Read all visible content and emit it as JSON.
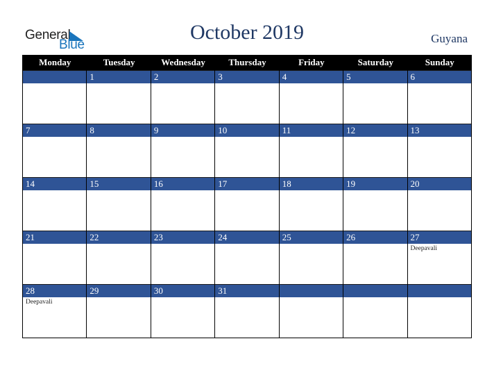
{
  "logo": {
    "word1": "General",
    "word2": "Blue"
  },
  "title": "October 2019",
  "country": "Guyana",
  "colors": {
    "title": "#1f3864",
    "band": "#2f5496",
    "header": "#000000",
    "logo_blue": "#1a75bc"
  },
  "weekdays": [
    "Monday",
    "Tuesday",
    "Wednesday",
    "Thursday",
    "Friday",
    "Saturday",
    "Sunday"
  ],
  "weeks": [
    [
      {
        "day": "",
        "event": ""
      },
      {
        "day": "1",
        "event": ""
      },
      {
        "day": "2",
        "event": ""
      },
      {
        "day": "3",
        "event": ""
      },
      {
        "day": "4",
        "event": ""
      },
      {
        "day": "5",
        "event": ""
      },
      {
        "day": "6",
        "event": ""
      }
    ],
    [
      {
        "day": "7",
        "event": ""
      },
      {
        "day": "8",
        "event": ""
      },
      {
        "day": "9",
        "event": ""
      },
      {
        "day": "10",
        "event": ""
      },
      {
        "day": "11",
        "event": ""
      },
      {
        "day": "12",
        "event": ""
      },
      {
        "day": "13",
        "event": ""
      }
    ],
    [
      {
        "day": "14",
        "event": ""
      },
      {
        "day": "15",
        "event": ""
      },
      {
        "day": "16",
        "event": ""
      },
      {
        "day": "17",
        "event": ""
      },
      {
        "day": "18",
        "event": ""
      },
      {
        "day": "19",
        "event": ""
      },
      {
        "day": "20",
        "event": ""
      }
    ],
    [
      {
        "day": "21",
        "event": ""
      },
      {
        "day": "22",
        "event": ""
      },
      {
        "day": "23",
        "event": ""
      },
      {
        "day": "24",
        "event": ""
      },
      {
        "day": "25",
        "event": ""
      },
      {
        "day": "26",
        "event": ""
      },
      {
        "day": "27",
        "event": "Deepavali"
      }
    ],
    [
      {
        "day": "28",
        "event": "Deepavali"
      },
      {
        "day": "29",
        "event": ""
      },
      {
        "day": "30",
        "event": ""
      },
      {
        "day": "31",
        "event": ""
      },
      {
        "day": "",
        "event": ""
      },
      {
        "day": "",
        "event": ""
      },
      {
        "day": "",
        "event": ""
      }
    ]
  ]
}
